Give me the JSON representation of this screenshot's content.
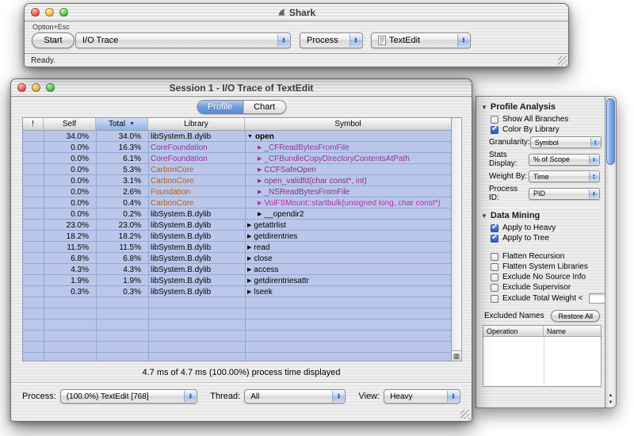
{
  "colors": {
    "row_blue": "#bac7ea",
    "row_line_blue": "#94a6d6",
    "sorted_header_blue": "#8fb2e4",
    "selected_tab_blue": "#6d9bdf",
    "library_purple": "#993399",
    "library_orange": "#c05a12",
    "symbol_purple": "#8b2d8b",
    "symbol_magenta": "#b32db3"
  },
  "shark_window": {
    "title": "Shark",
    "shortcut_hint": "Option+Esc",
    "start_button_label": "Start",
    "config_popup_value": "I/O Trace",
    "target_type_popup_value": "Process",
    "target_popup_value": "TextEdit",
    "status_text": "Ready."
  },
  "session_window": {
    "title": "Session 1 - I/O Trace of TextEdit",
    "tabs": [
      {
        "label": "Profile",
        "selected": true
      },
      {
        "label": "Chart",
        "selected": false
      }
    ],
    "table": {
      "columns": [
        "!",
        "Self",
        "Total",
        "Library",
        "Symbol"
      ],
      "sorted_column": "Total",
      "sort_direction": "descending",
      "rows": [
        {
          "self": "34.0%",
          "total": "34.0%",
          "library": "libSystem.B.dylib",
          "symbol": "open",
          "indent": 0,
          "expanded": true,
          "bold": true,
          "lib_color": "#000000",
          "sym_color": "#000000"
        },
        {
          "self": "0.0%",
          "total": "16.3%",
          "library": "CoreFoundation",
          "symbol": "_CFReadBytesFromFile",
          "indent": 1,
          "expanded": false,
          "bold": false,
          "lib_color": "#993399",
          "sym_color": "#993399"
        },
        {
          "self": "0.0%",
          "total": "6.1%",
          "library": "CoreFoundation",
          "symbol": "_CFBundleCopyDirectoryContentsAtPath",
          "indent": 1,
          "expanded": false,
          "bold": false,
          "lib_color": "#993399",
          "sym_color": "#993399"
        },
        {
          "self": "0.0%",
          "total": "5.3%",
          "library": "CarbonCore",
          "symbol": "CCFSafeOpen",
          "indent": 1,
          "expanded": false,
          "bold": false,
          "lib_color": "#c05a12",
          "sym_color": "#8b2d8b"
        },
        {
          "self": "0.0%",
          "total": "3.1%",
          "library": "CarbonCore",
          "symbol": "open_validfd(char const*, int)",
          "indent": 1,
          "expanded": false,
          "bold": false,
          "lib_color": "#c05a12",
          "sym_color": "#8b2d8b"
        },
        {
          "self": "0.0%",
          "total": "2.6%",
          "library": "Foundation",
          "symbol": "_NSReadBytesFromFile",
          "indent": 1,
          "expanded": false,
          "bold": false,
          "lib_color": "#c05a12",
          "sym_color": "#8b2d8b"
        },
        {
          "self": "0.0%",
          "total": "0.4%",
          "library": "CarbonCore",
          "symbol": "VolFSMount::startbulk(unsigned long, char const*)",
          "indent": 1,
          "expanded": false,
          "bold": false,
          "lib_color": "#c05a12",
          "sym_color": "#b32db3"
        },
        {
          "self": "0.0%",
          "total": "0.2%",
          "library": "libSystem.B.dylib",
          "symbol": "__opendir2",
          "indent": 1,
          "expanded": false,
          "bold": false,
          "lib_color": "#000000",
          "sym_color": "#000000"
        },
        {
          "self": "23.0%",
          "total": "23.0%",
          "library": "libSystem.B.dylib",
          "symbol": "getattrlist",
          "indent": 0,
          "expanded": false,
          "bold": false,
          "lib_color": "#000000",
          "sym_color": "#000000"
        },
        {
          "self": "18.2%",
          "total": "18.2%",
          "library": "libSystem.B.dylib",
          "symbol": "getdirentries",
          "indent": 0,
          "expanded": false,
          "bold": false,
          "lib_color": "#000000",
          "sym_color": "#000000"
        },
        {
          "self": "11.5%",
          "total": "11.5%",
          "library": "libSystem.B.dylib",
          "symbol": "read",
          "indent": 0,
          "expanded": false,
          "bold": false,
          "lib_color": "#000000",
          "sym_color": "#000000"
        },
        {
          "self": "6.8%",
          "total": "6.8%",
          "library": "libSystem.B.dylib",
          "symbol": "close",
          "indent": 0,
          "expanded": false,
          "bold": false,
          "lib_color": "#000000",
          "sym_color": "#000000"
        },
        {
          "self": "4.3%",
          "total": "4.3%",
          "library": "libSystem.B.dylib",
          "symbol": "access",
          "indent": 0,
          "expanded": false,
          "bold": false,
          "lib_color": "#000000",
          "sym_color": "#000000"
        },
        {
          "self": "1.9%",
          "total": "1.9%",
          "library": "libSystem.B.dylib",
          "symbol": "getdirentriesattr",
          "indent": 0,
          "expanded": false,
          "bold": false,
          "lib_color": "#000000",
          "sym_color": "#000000"
        },
        {
          "self": "0.3%",
          "total": "0.3%",
          "library": "libSystem.B.dylib",
          "symbol": "lseek",
          "indent": 0,
          "expanded": false,
          "bold": false,
          "lib_color": "#000000",
          "sym_color": "#000000"
        }
      ]
    },
    "status_line": "4.7 ms of 4.7 ms (100.00%) process time displayed",
    "footer": {
      "process_label": "Process:",
      "process_value": "(100.0%) TextEdit [768]",
      "thread_label": "Thread:",
      "thread_value": "All",
      "view_label": "View:",
      "view_value": "Heavy"
    }
  },
  "drawer": {
    "profile_analysis": {
      "title": "Profile Analysis",
      "checkboxes": [
        {
          "label": "Show All Branches",
          "checked": false
        },
        {
          "label": "Color By Library",
          "checked": true
        }
      ],
      "popups": [
        {
          "label": "Granularity:",
          "value": "Symbol"
        },
        {
          "label": "Stats Display:",
          "value": "% of Scope"
        },
        {
          "label": "Weight By:",
          "value": "Time"
        },
        {
          "label": "Process ID:",
          "value": "PID"
        }
      ]
    },
    "data_mining": {
      "title": "Data Mining",
      "apply_checkboxes": [
        {
          "label": "Apply to Heavy",
          "checked": true
        },
        {
          "label": "Apply to Tree",
          "checked": true
        }
      ],
      "filter_checkboxes": [
        {
          "label": "Flatten Recursion",
          "checked": false
        },
        {
          "label": "Flatten System Libraries",
          "checked": false
        },
        {
          "label": "Exclude No Source Info",
          "checked": false
        },
        {
          "label": "Exclude Supervisor",
          "checked": false
        },
        {
          "label": "Exclude Total Weight <",
          "checked": false,
          "has_field": true,
          "field_value": ""
        }
      ],
      "excluded_names_label": "Excluded Names",
      "restore_all_button_label": "Restore All",
      "excluded_table_columns": [
        "Operation",
        "Name"
      ]
    }
  }
}
